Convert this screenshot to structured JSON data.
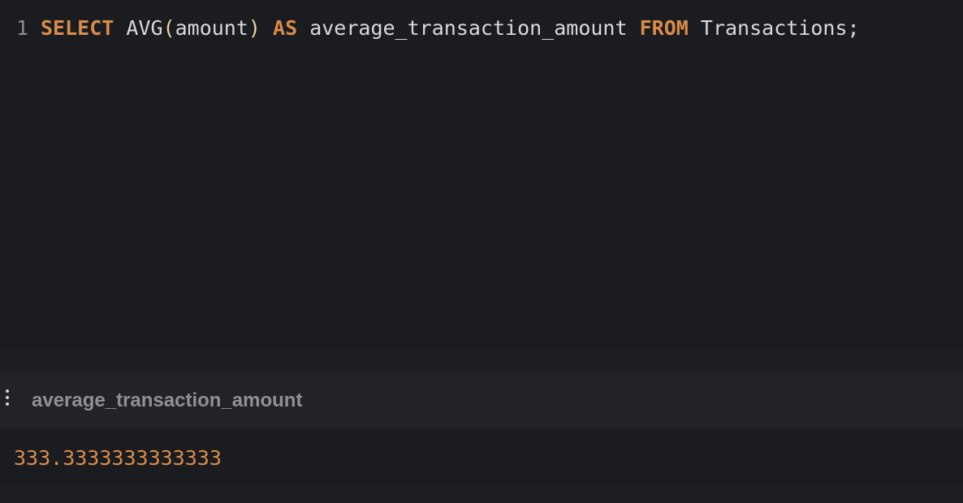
{
  "editor": {
    "line_number": "1",
    "tokens": {
      "select": "SELECT",
      "func": "AVG",
      "open_paren": "(",
      "arg": "amount",
      "close_paren": ")",
      "as": "AS",
      "alias": "average_transaction_amount",
      "from": "FROM",
      "table": "Transactions;"
    }
  },
  "results": {
    "columns": [
      "average_transaction_amount"
    ],
    "rows": [
      [
        "333.3333333333333"
      ]
    ]
  },
  "colors": {
    "background": "#1b1c20",
    "keyword": "#d98c4a",
    "numeric_value": "#d98c4a",
    "header_text": "#8f9095"
  },
  "icons": {
    "drag_handle": "vertical-dots-icon"
  }
}
